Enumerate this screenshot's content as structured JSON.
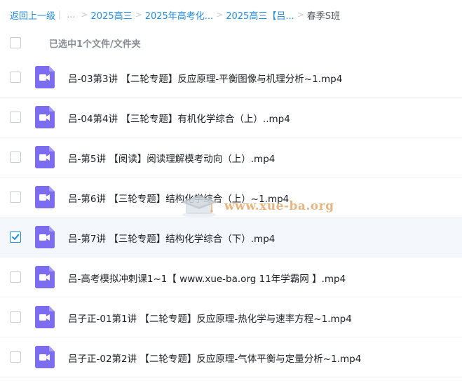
{
  "breadcrumb": {
    "back": "返回上一级",
    "divider": "|",
    "ellipsis": "...",
    "sep": ">",
    "items": [
      "2025高三",
      "2025年高考化...",
      "2025高三【吕..."
    ],
    "current": "春季S班"
  },
  "header": {
    "selection_text": "已选中1个文件/文件夹"
  },
  "files": [
    {
      "name": "吕-03第3讲 【二轮专题】反应原理-平衡图像与机理分析~1.mp4",
      "checked": false
    },
    {
      "name": "吕-04第4讲 【三轮专题】有机化学综合（上）..mp4",
      "checked": false
    },
    {
      "name": "吕-第5讲 【阅读】阅读理解模考动向（上）.mp4",
      "checked": false
    },
    {
      "name": "吕-第6讲 【三轮专题】结构化学综合（上）~1.mp4",
      "checked": false
    },
    {
      "name": "吕-第7讲 【三轮专题】结构化学综合（下）.mp4",
      "checked": true
    },
    {
      "name": "吕-高考模拟冲刺课1~1【 www.xue-ba.org 11年学霸网 】.mp4",
      "checked": false
    },
    {
      "name": "吕子正-01第1讲 【二轮专题】反应原理-热化学与速率方程~1.mp4",
      "checked": false
    },
    {
      "name": "吕子正-02第2讲 【二轮专题】反应原理-气体平衡与定量分析~1.mp4",
      "checked": false
    }
  ],
  "watermark": {
    "text": "www.xue-ba.org"
  },
  "colors": {
    "link": "#1f8ee6",
    "video_icon": "#7b6cf0",
    "watermark": "#e5a86a"
  },
  "icons": {
    "file": "video-file-icon",
    "check": "check-icon"
  }
}
